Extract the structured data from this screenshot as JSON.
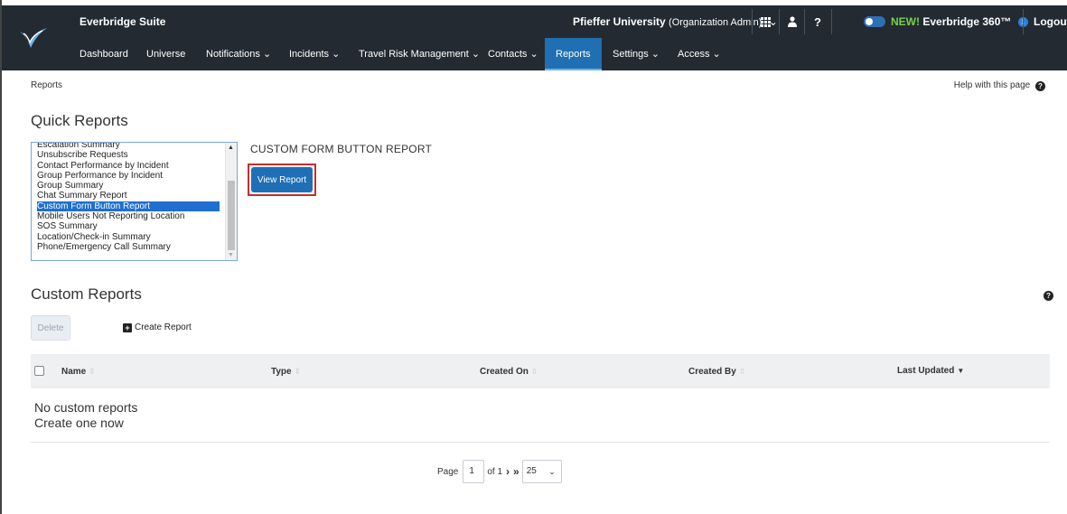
{
  "header": {
    "brand": "Everbridge Suite",
    "org_name": "Pfieffer University",
    "org_role": "(Organization Admin)",
    "e360_new": "NEW!",
    "e360_label": "Everbridge 360™",
    "logout": "Logout"
  },
  "nav": [
    {
      "label": "Dashboard"
    },
    {
      "label": "Universe"
    },
    {
      "label": "Notifications ⌄"
    },
    {
      "label": "Incidents ⌄"
    },
    {
      "label": "Travel Risk Management ⌄"
    },
    {
      "label": "Contacts ⌄"
    },
    {
      "label": "Reports"
    },
    {
      "label": "Settings ⌄"
    },
    {
      "label": "Access ⌄"
    }
  ],
  "breadcrumb": "Reports",
  "help_link": "Help with this page",
  "quick_reports": {
    "title": "Quick Reports",
    "items": [
      "Escalation Summary",
      "Unsubscribe Requests",
      "Contact Performance by Incident",
      "Group Performance by Incident",
      "Group Summary",
      "Chat Summary Report",
      "Custom Form Button Report",
      "Mobile Users Not Reporting Location",
      "SOS Summary",
      "Location/Check-in Summary",
      "Phone/Emergency Call Summary"
    ],
    "selected": "Custom Form Button Report",
    "selected_heading": "CUSTOM FORM BUTTON REPORT",
    "view_button": "View Report"
  },
  "custom_reports": {
    "title": "Custom Reports",
    "delete_button": "Delete",
    "create_button": "Create Report",
    "columns": [
      "Name",
      "Type",
      "Created On",
      "Created By",
      "Last Updated"
    ],
    "empty_line1": "No custom reports",
    "empty_line2": "Create one now"
  },
  "pagination": {
    "page_label": "Page",
    "page_value": "1",
    "of_label": "of 1",
    "per_page": "25"
  },
  "colors": {
    "topbar": "#232a32",
    "active_tab": "#1f6fb2",
    "primary_button": "#1e6fb5",
    "highlight_border": "#d02b2b",
    "new_badge": "#7bd148"
  }
}
